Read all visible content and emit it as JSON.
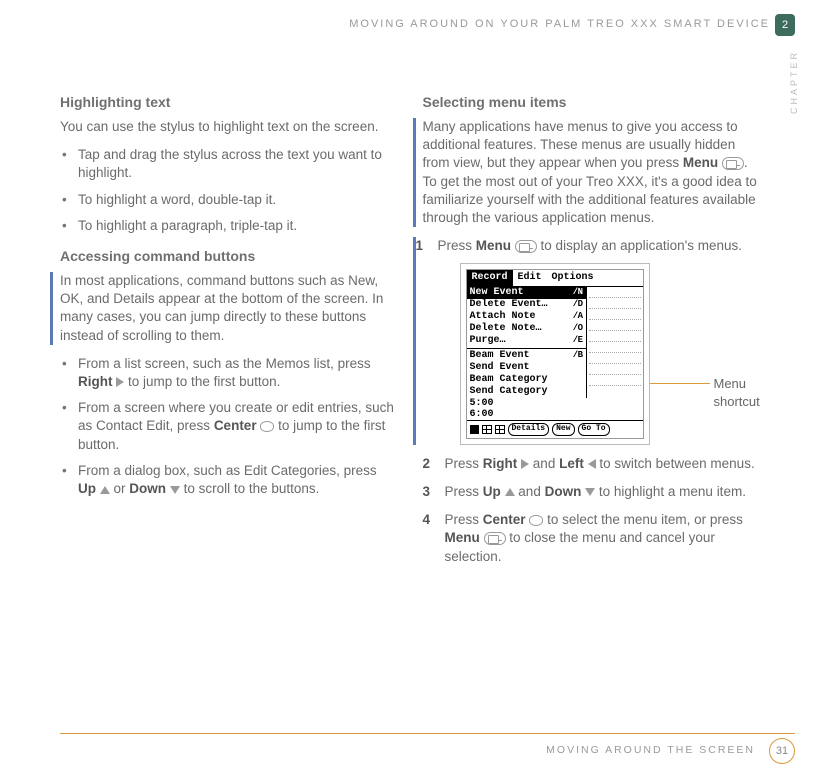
{
  "header": {
    "running_head": "MOVING AROUND ON YOUR PALM TREO XXX SMART DEVICE",
    "chapter_number": "2",
    "chapter_label": "CHAPTER"
  },
  "left": {
    "h_highlight": "Highlighting text",
    "p_highlight_intro": "You can use the stylus to highlight text on the screen.",
    "bullets_highlight": [
      "Tap and drag the stylus across the text you want to highlight.",
      "To highlight a word, double-tap it.",
      "To highlight a paragraph, triple-tap it."
    ],
    "h_cmd": "Accessing command buttons",
    "p_cmd_intro": "In most applications, command buttons such as New, OK, and Details appear at the bottom of the screen. In many cases, you can jump directly to these buttons instead of scrolling to them.",
    "bullets_cmd": {
      "0_pre": "From a list screen, such as the Memos list, press ",
      "0_bold": "Right",
      "0_post": " to jump to the first button.",
      "1_pre": "From a screen where you create or edit entries, such as Contact Edit, press ",
      "1_bold": "Center",
      "1_post": " to jump to the first button.",
      "2_pre": "From a dialog box, such as Edit Categories, press ",
      "2_bold1": "Up",
      "2_mid": " or ",
      "2_bold2": "Down",
      "2_post": " to scroll to the buttons."
    }
  },
  "right": {
    "h_sel": "Selecting menu items",
    "p_sel_intro_a": "Many applications have menus to give you access to additional features. These menus are usually hidden from view, but they appear when you press ",
    "p_sel_intro_bold": "Menu",
    "p_sel_intro_b": ". To get the most out of your Treo XXX, it's a good idea to familiarize yourself with the additional features available through the various application menus.",
    "steps": {
      "1_pre": "Press ",
      "1_bold": "Menu",
      "1_post": " to display an application's menus.",
      "2_pre": "Press ",
      "2_b1": "Right",
      "2_mid": " and ",
      "2_b2": "Left",
      "2_post": " to switch between menus.",
      "3_pre": "Press ",
      "3_b1": "Up",
      "3_mid": " and ",
      "3_b2": "Down",
      "3_post": " to highlight a menu item.",
      "4_pre": "Press ",
      "4_b1": "Center",
      "4_mid": " to select the menu item, or press ",
      "4_b2": "Menu",
      "4_post": " to close the menu and cancel your selection."
    },
    "callout": "Menu shortcut",
    "screenshot": {
      "menubar": [
        "Record",
        "Edit",
        "Options"
      ],
      "active_tab": "Record",
      "items": [
        {
          "label": "New Event",
          "shortcut": "/N",
          "highlight": true
        },
        {
          "label": "Delete Event…",
          "shortcut": "/D"
        },
        {
          "label": "Attach Note",
          "shortcut": "/A"
        },
        {
          "label": "Delete Note…",
          "shortcut": "/O"
        },
        {
          "label": "Purge…",
          "shortcut": "/E"
        }
      ],
      "items2": [
        {
          "label": "Beam Event",
          "shortcut": "/B"
        },
        {
          "label": "Send Event",
          "shortcut": ""
        },
        {
          "label": "Beam Category",
          "shortcut": ""
        },
        {
          "label": "Send Category",
          "shortcut": ""
        }
      ],
      "times": [
        "5:00",
        "6:00"
      ],
      "buttons": [
        "Details",
        "New",
        "Go To"
      ]
    }
  },
  "footer": {
    "text": "MOVING AROUND THE SCREEN",
    "page": "31"
  }
}
